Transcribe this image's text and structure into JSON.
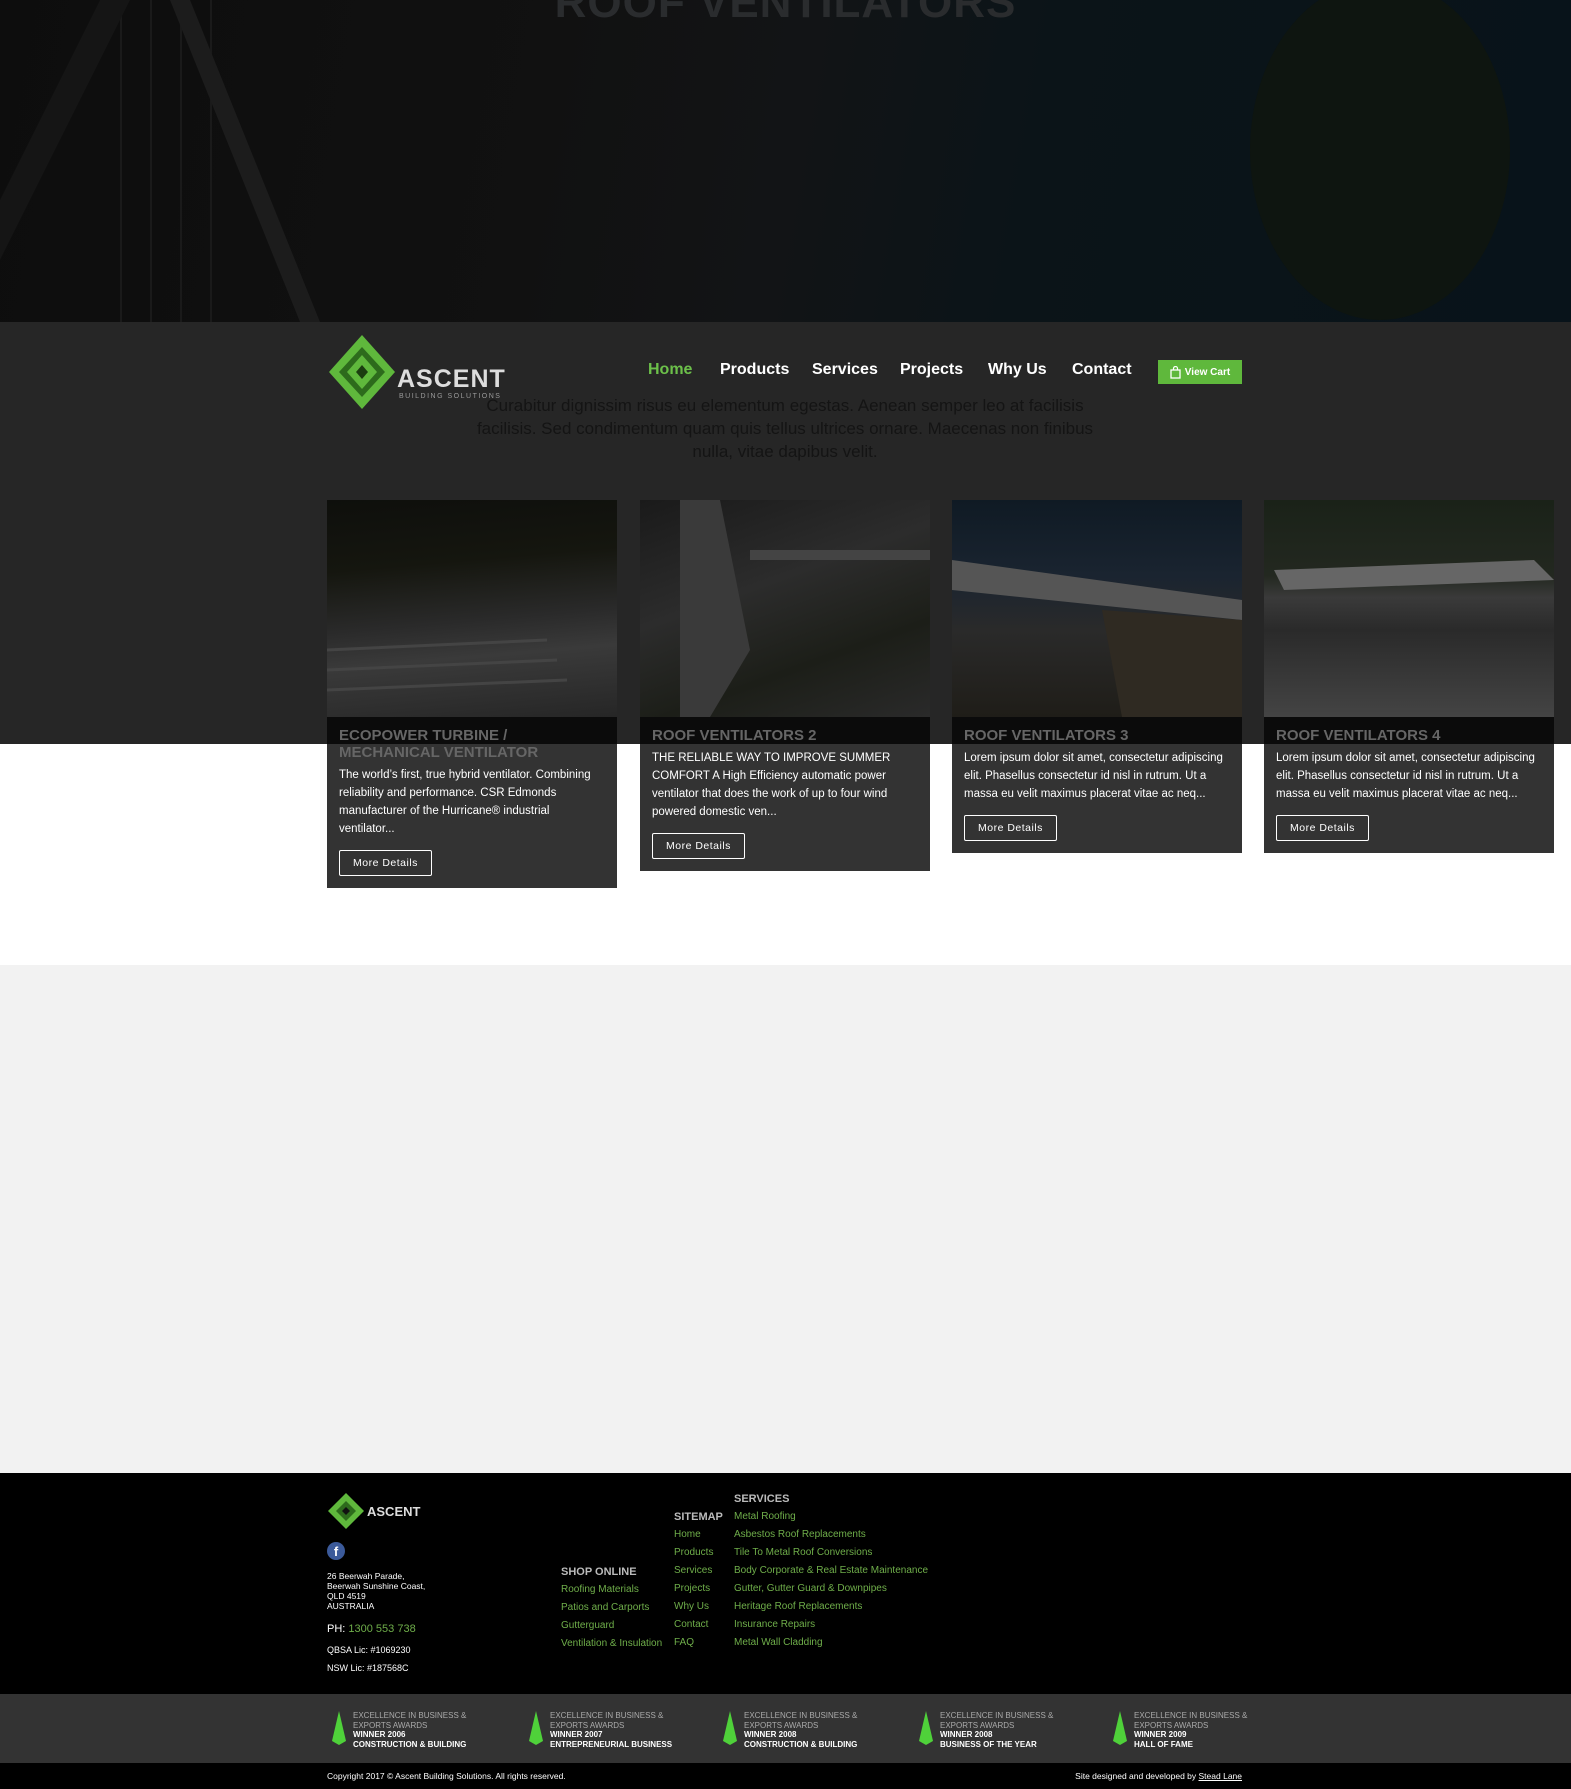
{
  "hero": {
    "title": "ROOF VENTILATORS"
  },
  "brand": {
    "name": "ASCENT",
    "tagline": "BUILDING SOLUTIONS",
    "accent": "#5fb83c"
  },
  "nav": {
    "items": [
      {
        "label": "Home",
        "active": true
      },
      {
        "label": "Products"
      },
      {
        "label": "Services"
      },
      {
        "label": "Projects"
      },
      {
        "label": "Why Us"
      },
      {
        "label": "Contact"
      }
    ],
    "cart_label": "View Cart"
  },
  "intro": "Curabitur dignissim risus eu elementum egestas. Aenean semper leo at facilisis facilisis. Sed condimentum quam quis tellus ultrices ornare. Maecenas non finibus nulla, vitae dapibus velit.",
  "cards": [
    {
      "title": "ECOPOWER TURBINE / MECHANICAL VENTILATOR",
      "text": "The world’s first, true hybrid ventilator. Combining reliability and performance. CSR Edmonds manufacturer of the Hurricane® industrial ventilator...",
      "button": "More Details"
    },
    {
      "title": "ROOF VENTILATORS 2",
      "text": "THE RELIABLE WAY TO IMPROVE SUMMER COMFORT A High Efficiency automatic power ventilator that does the work of up to four wind powered domestic ven...",
      "button": "More Details"
    },
    {
      "title": "ROOF VENTILATORS 3",
      "text": "Lorem ipsum dolor sit amet, consectetur adipiscing elit. Phasellus consectetur id nisl in rutrum. Ut a massa eu velit maximus placerat vitae ac neq...",
      "button": "More Details"
    },
    {
      "title": "ROOF VENTILATORS 4",
      "text": "Lorem ipsum dolor sit amet, consectetur adipiscing elit. Phasellus consectetur id nisl in rutrum. Ut a massa eu velit maximus placerat vitae ac neq...",
      "button": "More Details"
    }
  ],
  "footer": {
    "address": [
      "26 Beerwah Parade,",
      "Beerwah Sunshine Coast,",
      "QLD 4519",
      "AUSTRALIA"
    ],
    "phone_label": "PH:",
    "phone": "1300 553 738",
    "qbsa": "QBSA Lic: #1069230",
    "nsw": "NSW Lic: #187568C",
    "shop": {
      "heading": "SHOP ONLINE",
      "items": [
        "Roofing Materials",
        "Patios and Carports",
        "Gutterguard",
        "Ventilation & Insulation"
      ]
    },
    "sitemap": {
      "heading": "SITEMAP",
      "items": [
        "Home",
        "Products",
        "Services",
        "Projects",
        "Why Us",
        "Contact",
        "FAQ"
      ]
    },
    "services": {
      "heading": "SERVICES",
      "items": [
        "Metal Roofing",
        "Asbestos Roof Replacements",
        "Tile To Metal Roof Conversions",
        "Body Corporate & Real Estate Maintenance",
        "Gutter, Gutter Guard & Downpipes",
        "Heritage Roof Replacements",
        "Insurance Repairs",
        "Metal Wall Cladding"
      ]
    }
  },
  "awards": [
    {
      "l1": "EXCELLENCE IN BUSINESS &",
      "l2": "EXPORTS AWARDS",
      "l3": "WINNER 2006",
      "l4": "CONSTRUCTION & BUILDING"
    },
    {
      "l1": "EXCELLENCE IN BUSINESS &",
      "l2": "EXPORTS AWARDS",
      "l3": "WINNER 2007",
      "l4": "ENTREPRENEURIAL BUSINESS"
    },
    {
      "l1": "EXCELLENCE IN BUSINESS &",
      "l2": "EXPORTS AWARDS",
      "l3": "WINNER 2008",
      "l4": "CONSTRUCTION & BUILDING"
    },
    {
      "l1": "EXCELLENCE IN BUSINESS &",
      "l2": "EXPORTS AWARDS",
      "l3": "WINNER 2008",
      "l4": "BUSINESS OF THE YEAR"
    },
    {
      "l1": "EXCELLENCE IN BUSINESS &",
      "l2": "EXPORTS AWARDS",
      "l3": "WINNER 2009",
      "l4": "HALL OF FAME"
    }
  ],
  "bottom": {
    "copyright": "Copyright 2017 © Ascent Building Solutions. All rights reserved.",
    "credit": "Site designed and developed by",
    "credit_link": "Stead Lane"
  }
}
